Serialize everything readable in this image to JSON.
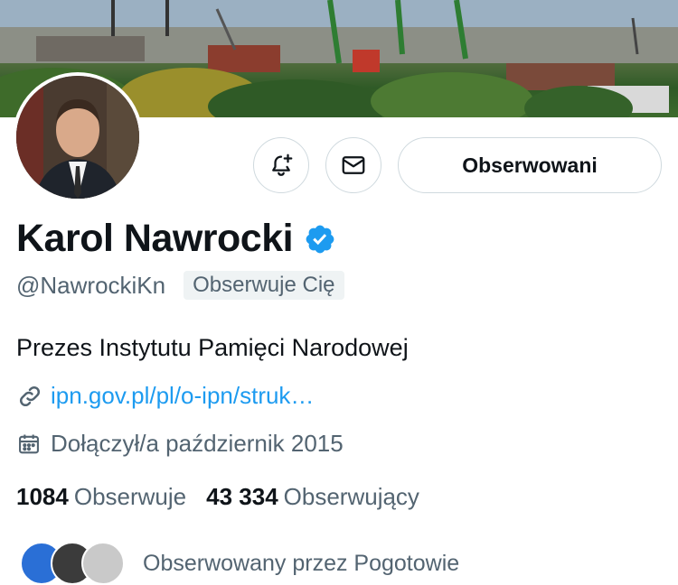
{
  "profile": {
    "name": "Karol Nawrocki",
    "handle": "@NawrockiKn",
    "follows_you_badge": "Obserwuje Cię",
    "bio": "Prezes Instytutu Pamięci Narodowej",
    "link": "ipn.gov.pl/pl/o-ipn/struk…",
    "joined": "Dołączył/a październik 2015",
    "verified": true
  },
  "actions": {
    "notify_icon": "bell-plus-icon",
    "message_icon": "envelope-icon",
    "follow_state_label": "Obserwowani"
  },
  "stats": {
    "following_count": "1084",
    "following_label": "Obserwuje",
    "followers_count": "43 334",
    "followers_label": "Obserwujący"
  },
  "followed_by": {
    "text": "Obserwowany przez Pogotowie"
  },
  "colors": {
    "accent": "#1d9bf0",
    "secondary_text": "#536471",
    "border": "#cfd9de"
  }
}
